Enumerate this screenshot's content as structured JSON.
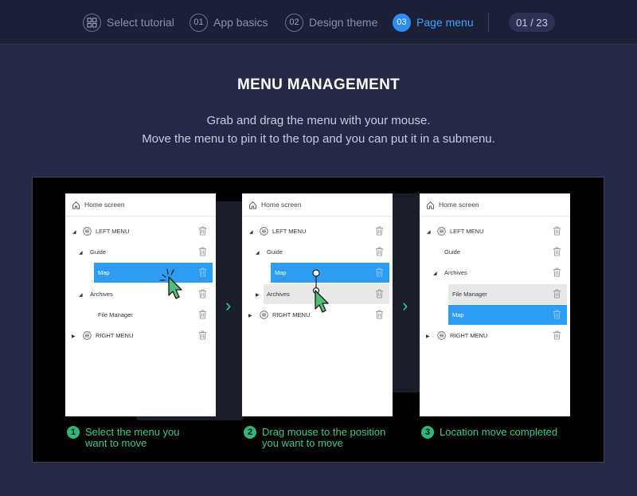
{
  "steps": [
    {
      "badge": "",
      "label": "Select tutorial",
      "icon": "grid-icon"
    },
    {
      "badge": "01",
      "label": "App basics"
    },
    {
      "badge": "02",
      "label": "Design theme"
    },
    {
      "badge": "03",
      "label": "Page menu",
      "active": true
    }
  ],
  "counter": "01 / 23",
  "title": "MENU MANAGEMENT",
  "description": [
    "Grab and drag the menu with your mouse.",
    "Move the menu to pin it to the top and you can put it in a submenu."
  ],
  "colors": {
    "accent": "#2d8cf0",
    "highlight": "#2d9cf3",
    "caption": "#3ec985",
    "background": "#252945"
  },
  "cards": [
    {
      "header": "Home screen",
      "rows": [
        "LEFT MENU",
        "Guide",
        "Map",
        "Archives",
        "File Manager",
        "RIGHT MENU"
      ]
    },
    {
      "header": "Home screen",
      "rows": [
        "LEFT MENU",
        "Guide",
        "Map",
        "Archives",
        "RIGHT MENU"
      ]
    },
    {
      "header": "Home screen",
      "rows": [
        "LEFT MENU",
        "Guide",
        "Archives",
        "File Manager",
        "Map",
        "RIGHT MENU"
      ]
    }
  ],
  "captions": [
    {
      "num": "1",
      "line1": "Select the menu you",
      "line2": "want to move"
    },
    {
      "num": "2",
      "line1": "Drag mouse to the position",
      "line2": "you want to move"
    },
    {
      "num": "3",
      "line1": "Location move completed",
      "line2": ""
    }
  ]
}
